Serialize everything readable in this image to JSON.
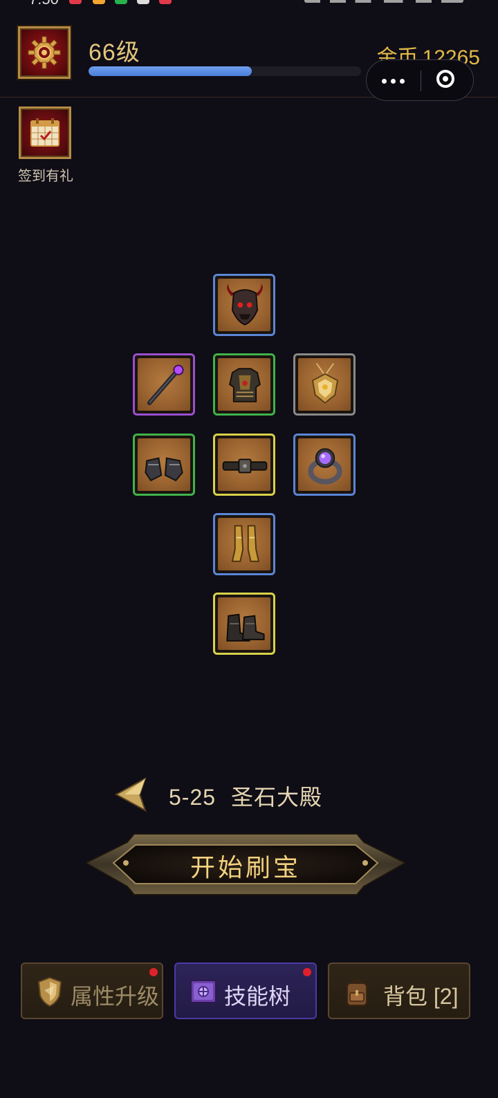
{
  "header": {
    "level_label": "66级",
    "xp_progress": 0.6,
    "gold_label": "金币",
    "gold_value": "12265"
  },
  "checkin": {
    "label": "签到有礼"
  },
  "equipment": [
    {
      "slot": "helmet",
      "icon": "demon-helmet-icon",
      "rarity_color": "#5a86d6"
    },
    {
      "slot": "weapon",
      "icon": "staff-icon",
      "rarity_color": "#9b4fd0"
    },
    {
      "slot": "armor",
      "icon": "chest-armor-icon",
      "rarity_color": "#3fb44a"
    },
    {
      "slot": "amulet",
      "icon": "amulet-icon",
      "rarity_color": "#8a8a8a"
    },
    {
      "slot": "gloves",
      "icon": "gauntlets-icon",
      "rarity_color": "#3fb44a"
    },
    {
      "slot": "belt",
      "icon": "belt-icon",
      "rarity_color": "#d8d24a"
    },
    {
      "slot": "ring",
      "icon": "ring-icon",
      "rarity_color": "#5a86d6"
    },
    {
      "slot": "legs",
      "icon": "greaves-icon",
      "rarity_color": "#5a86d6"
    },
    {
      "slot": "boots",
      "icon": "boots-icon",
      "rarity_color": "#d8d24a"
    }
  ],
  "stage": {
    "code": "5-25",
    "name": "圣石大殿"
  },
  "start_button": {
    "label": "开始刷宝"
  },
  "tabs": [
    {
      "label": "属性升级",
      "icon": "shield-icon",
      "badge": true
    },
    {
      "label": "技能树",
      "icon": "spellbook-icon",
      "badge": true
    },
    {
      "label": "背包 [2]",
      "icon": "backpack-icon",
      "badge": false
    }
  ]
}
